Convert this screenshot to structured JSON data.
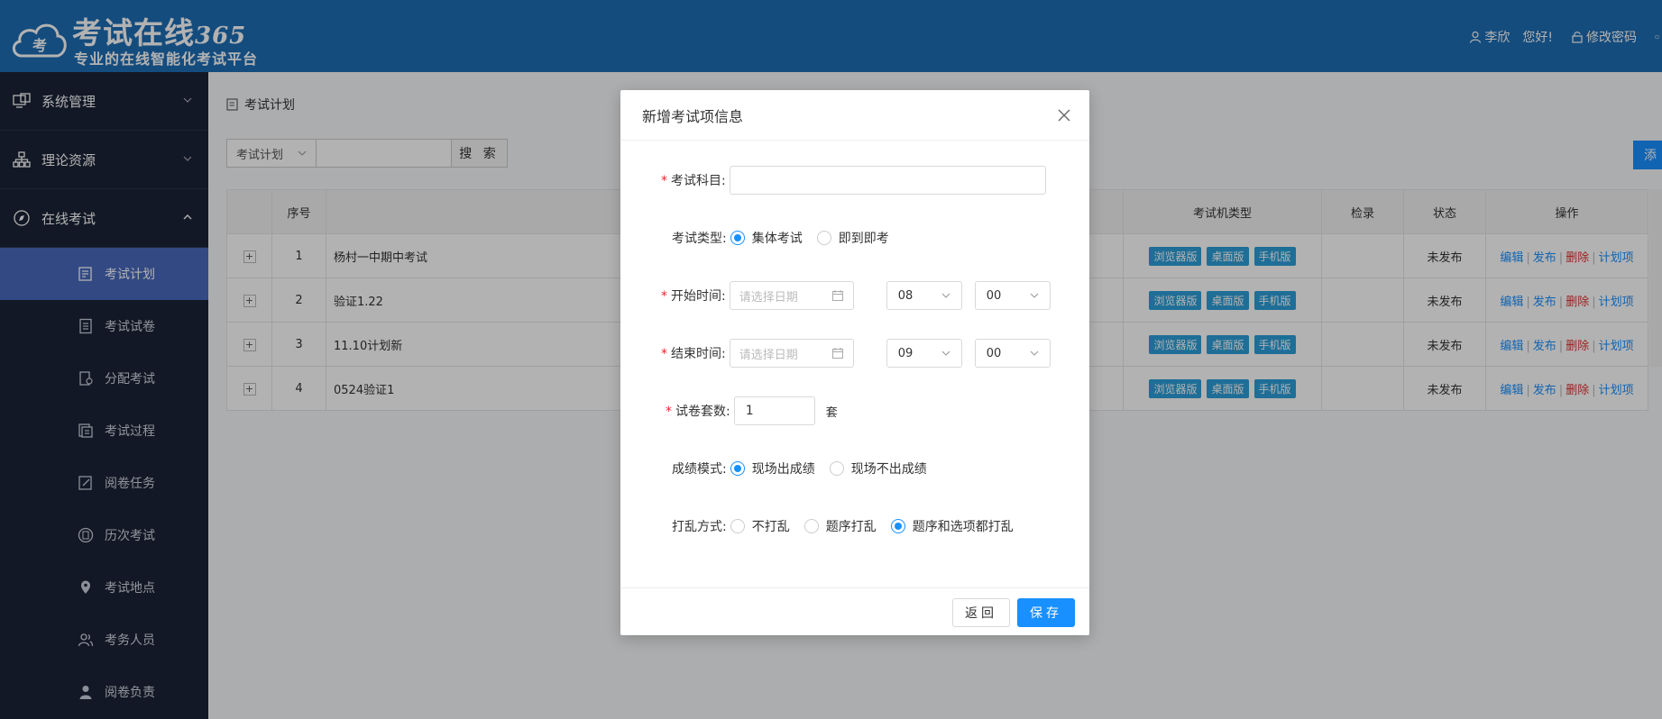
{
  "header": {
    "logo_title": "考试在线",
    "logo_number": "365",
    "logo_badge": "考",
    "slogan": "专业的在线智能化考试平台",
    "user_name": "李欣",
    "greeting": "您好!",
    "change_password": "修改密码"
  },
  "sidebar": {
    "groups": [
      {
        "label": "系统管理",
        "icon": "monitor-icon",
        "expanded": false
      },
      {
        "label": "理论资源",
        "icon": "hierarchy-icon",
        "expanded": false
      },
      {
        "label": "在线考试",
        "icon": "compass-icon",
        "expanded": true
      }
    ],
    "items": [
      {
        "label": "考试计划",
        "icon": "edit-icon",
        "active": true
      },
      {
        "label": "考试试卷",
        "icon": "paper-icon"
      },
      {
        "label": "分配考试",
        "icon": "assign-icon"
      },
      {
        "label": "考试过程",
        "icon": "process-icon"
      },
      {
        "label": "阅卷任务",
        "icon": "grading-icon"
      },
      {
        "label": "历次考试",
        "icon": "history-icon"
      },
      {
        "label": "考试地点",
        "icon": "location-icon"
      },
      {
        "label": "考务人员",
        "icon": "staff-icon"
      },
      {
        "label": "阅卷负责",
        "icon": "supervisor-icon"
      }
    ]
  },
  "main": {
    "breadcrumb": "考试计划",
    "filter_select": "考试计划",
    "search_button": "搜 索",
    "add_button": "添",
    "table": {
      "headers": [
        "序号",
        "考试机类型",
        "检录",
        "状态",
        "操作"
      ],
      "tags": [
        "浏览器版",
        "桌面版",
        "手机版"
      ],
      "ops": [
        "编辑",
        "发布",
        "删除",
        "计划项"
      ],
      "rows": [
        {
          "no": "1",
          "name": "杨村一中期中考试",
          "status": "未发布"
        },
        {
          "no": "2",
          "name": "验证1.22",
          "status": "未发布"
        },
        {
          "no": "3",
          "name": "11.10计划新",
          "status": "未发布"
        },
        {
          "no": "4",
          "name": "0524验证1",
          "status": "未发布"
        }
      ]
    }
  },
  "modal": {
    "title": "新增考试项信息",
    "subject_label": "考试科目:",
    "subject_value": "",
    "exam_type_label": "考试类型:",
    "exam_type_options": [
      "集体考试",
      "即到即考"
    ],
    "exam_type_selected": "集体考试",
    "start_label": "开始时间:",
    "start_date_placeholder": "请选择日期",
    "start_hour": "08",
    "start_minute": "00",
    "end_label": "结束时间:",
    "end_date_placeholder": "请选择日期",
    "end_hour": "09",
    "end_minute": "00",
    "paper_count_label": "试卷套数:",
    "paper_count_value": "1",
    "paper_count_unit": "套",
    "score_mode_label": "成绩模式:",
    "score_mode_options": [
      "现场出成绩",
      "现场不出成绩"
    ],
    "score_mode_selected": "现场出成绩",
    "shuffle_label": "打乱方式:",
    "shuffle_options": [
      "不打乱",
      "题序打乱",
      "题序和选项都打乱"
    ],
    "shuffle_selected": "题序和选项都打乱",
    "back_button": "返回",
    "save_button": "保存"
  },
  "colors": {
    "header_bg": "#1e6eb5",
    "sidebar_bg": "#1b2336",
    "active_menu": "#4a69bd",
    "primary": "#1890ff",
    "tag": "#2b9ed8",
    "danger": "#e03030"
  }
}
